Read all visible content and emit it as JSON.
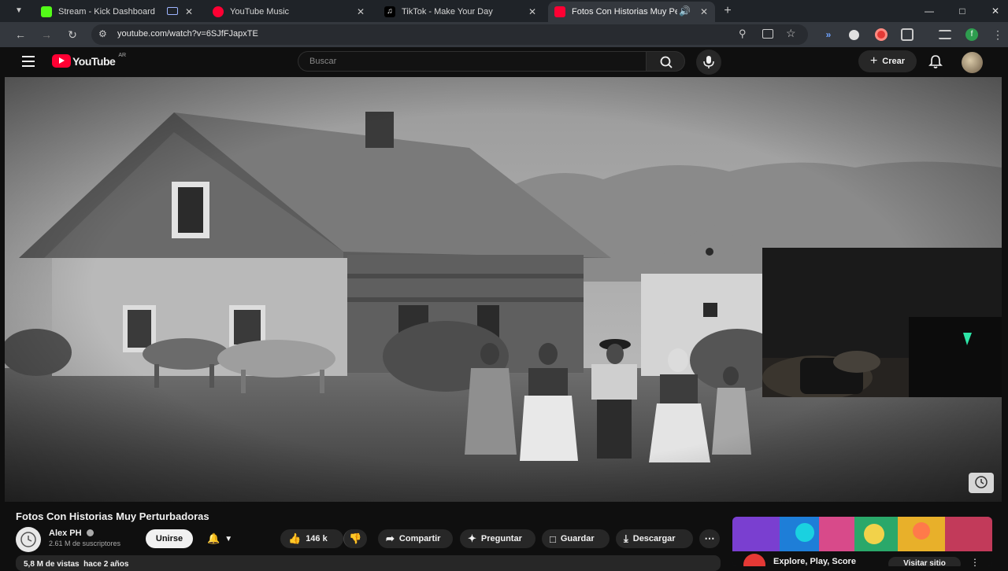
{
  "browser": {
    "tabs": [
      {
        "label": "Stream - Kick Dashboard",
        "active": false,
        "favicon_color": "#53fc18"
      },
      {
        "label": "YouTube Music",
        "active": false,
        "favicon_color": "#ff0033"
      },
      {
        "label": "TikTok - Make Your Day",
        "active": false,
        "favicon_color": "#111111"
      },
      {
        "label": "Fotos Con Historias Muy Pe",
        "active": true,
        "favicon_color": "#ff0033"
      }
    ],
    "url": "youtube.com/watch?v=6SJfFJapxTE",
    "profile_initial": "f",
    "window_controls": [
      "minimize-icon",
      "maximize-icon",
      "close-icon"
    ]
  },
  "youtube": {
    "logo_text": "YouTube",
    "country_code": "AR",
    "search_placeholder": "Buscar",
    "create_label": "Crear"
  },
  "video": {
    "title": "Fotos Con Historias Muy Perturbadoras",
    "channel_name": "Alex PH",
    "subscribers": "2.61 M de suscriptores",
    "join_label": "Unirse",
    "like_count": "146 k",
    "share_label": "Compartir",
    "ask_label": "Preguntar",
    "save_label": "Guardar",
    "download_label": "Descargar",
    "views_date": "5,8 M de vistas  hace 2 años"
  },
  "ad": {
    "title": "Explore, Play, Score",
    "cta_label": "Visitar sitio"
  },
  "colors": {
    "yt_red": "#ff0033",
    "background": "#0f0f0f",
    "chip": "#272727",
    "browser_chrome": "#34383e"
  }
}
